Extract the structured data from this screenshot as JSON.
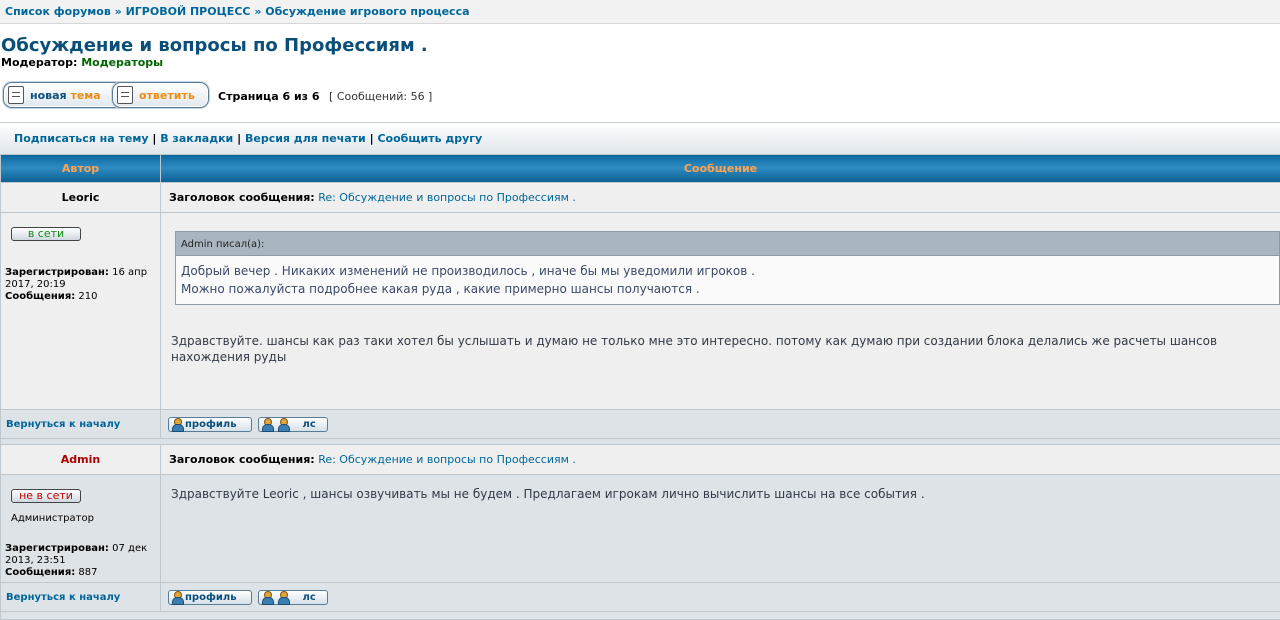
{
  "breadcrumb": {
    "items": [
      "Список форумов",
      "ИГРОВОЙ ПРОЦЕСС",
      "Обсуждение игрового процесса"
    ],
    "separator": "»"
  },
  "forum": {
    "title": "Обсуждение и вопросы по Профессиям .",
    "moderator_label": "Модератор:",
    "moderator_value": "Модераторы"
  },
  "actions": {
    "new_topic_word1": "новая",
    "new_topic_word2": "тема",
    "reply_label": "ответить"
  },
  "pagination": {
    "text": "Страница 6 из 6",
    "count": "[ Сообщений: 56 ]"
  },
  "topic_links": {
    "subscribe": "Подписаться на тему",
    "bookmark": "В закладки",
    "print": "Версия для печати",
    "tell_friend": "Сообщить другу",
    "separator": "|"
  },
  "table_header": {
    "author": "Автор",
    "message": "Сообщение"
  },
  "common": {
    "subject_label": "Заголовок сообщения:",
    "back_to_top": "Вернуться к началу",
    "profile_btn": "профиль",
    "pm_btn": "лс",
    "registered_label": "Зарегистрирован:",
    "posts_label": "Сообщения:"
  },
  "posts": [
    {
      "author": "Leoric",
      "subject": "Re: Обсуждение и вопросы по Профессиям .",
      "status": "в сети",
      "registered": "16 апр 2017, 20:19",
      "posts_count": "210",
      "quote_author": "Admin писал(а):",
      "quote_line1": "Добрый вечер . Никаких изменений не производилось , иначе бы мы уведомили игроков .",
      "quote_line2": "Можно пожалуйста подробнее какая руда , какие примерно шансы получаются .",
      "text": "Здравствуйте. шансы как раз таки хотел бы услышать и думаю не только мне это интересно. потому как думаю при создании блока делались же расчеты шансов нахождения руды"
    },
    {
      "author": "Admin",
      "subject": "Re: Обсуждение и вопросы по Профессиям .",
      "status": "не в сети",
      "rank": "Администратор",
      "registered": "07 дек 2013, 23:51",
      "posts_count": "887",
      "text": "Здравствуйте Leoric , шансы озвучивать мы не будем . Предлагаем игрокам лично вычислить шансы на все события ."
    }
  ],
  "colors": {
    "link": "#006699",
    "header_text": "#ffa34f",
    "admin_name": "#aa0000",
    "online": "#138c13",
    "offline": "#c00000"
  }
}
